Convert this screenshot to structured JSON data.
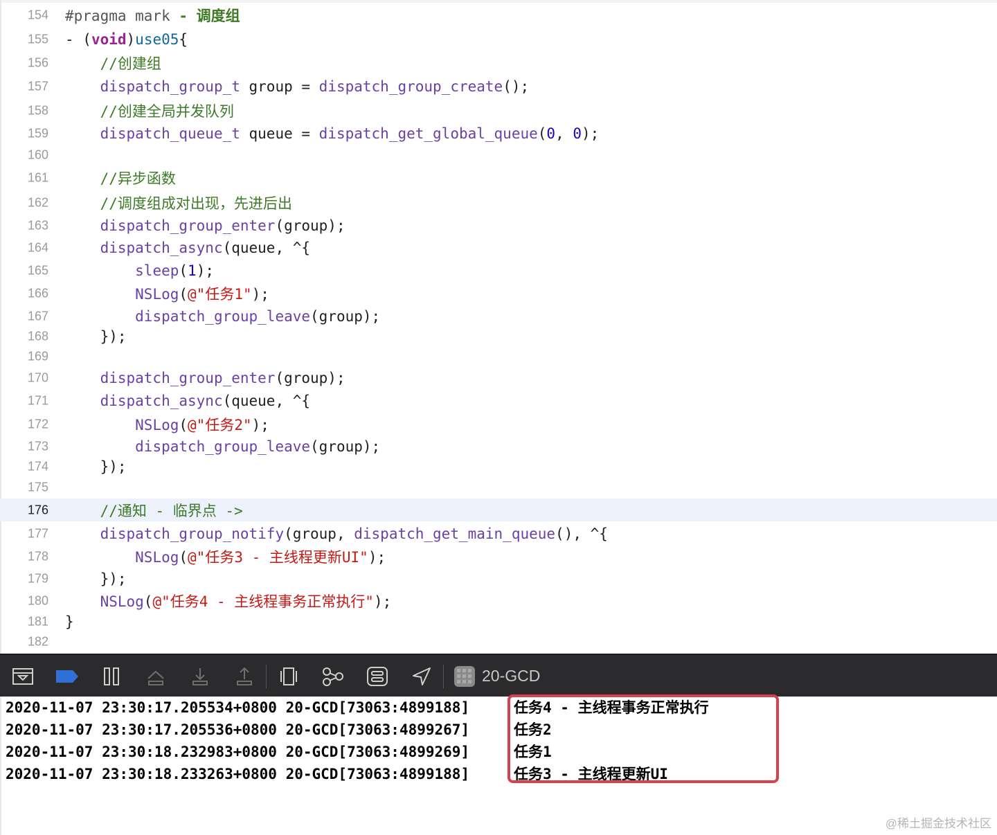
{
  "editor": {
    "current_line": "176",
    "lines": [
      {
        "num": "154",
        "tokens": [
          {
            "t": "#pragma mark ",
            "c": "hash"
          },
          {
            "t": "- 调度组",
            "c": "mark"
          }
        ]
      },
      {
        "num": "155",
        "tokens": [
          {
            "t": "- (",
            "c": "plain"
          },
          {
            "t": "void",
            "c": "kw"
          },
          {
            "t": ")",
            "c": "plain"
          },
          {
            "t": "use05",
            "c": "def"
          },
          {
            "t": "{",
            "c": "plain"
          }
        ]
      },
      {
        "num": "156",
        "tokens": [
          {
            "t": "    //创建组",
            "c": "com"
          }
        ]
      },
      {
        "num": "157",
        "tokens": [
          {
            "t": "    ",
            "c": "plain"
          },
          {
            "t": "dispatch_group_t",
            "c": "fn"
          },
          {
            "t": " group = ",
            "c": "plain"
          },
          {
            "t": "dispatch_group_create",
            "c": "fn"
          },
          {
            "t": "();",
            "c": "plain"
          }
        ]
      },
      {
        "num": "158",
        "tokens": [
          {
            "t": "    //创建全局并发队列",
            "c": "com"
          }
        ]
      },
      {
        "num": "159",
        "tokens": [
          {
            "t": "    ",
            "c": "plain"
          },
          {
            "t": "dispatch_queue_t",
            "c": "fn"
          },
          {
            "t": " queue = ",
            "c": "plain"
          },
          {
            "t": "dispatch_get_global_queue",
            "c": "fn"
          },
          {
            "t": "(",
            "c": "plain"
          },
          {
            "t": "0",
            "c": "num"
          },
          {
            "t": ", ",
            "c": "plain"
          },
          {
            "t": "0",
            "c": "num"
          },
          {
            "t": ");",
            "c": "plain"
          }
        ]
      },
      {
        "num": "160",
        "tokens": []
      },
      {
        "num": "161",
        "tokens": [
          {
            "t": "    //异步函数",
            "c": "com"
          }
        ]
      },
      {
        "num": "162",
        "tokens": [
          {
            "t": "    //调度组成对出现，先进后出",
            "c": "com"
          }
        ]
      },
      {
        "num": "163",
        "tokens": [
          {
            "t": "    ",
            "c": "plain"
          },
          {
            "t": "dispatch_group_enter",
            "c": "fn"
          },
          {
            "t": "(group);",
            "c": "plain"
          }
        ]
      },
      {
        "num": "164",
        "tokens": [
          {
            "t": "    ",
            "c": "plain"
          },
          {
            "t": "dispatch_async",
            "c": "fn"
          },
          {
            "t": "(queue, ^{",
            "c": "plain"
          }
        ]
      },
      {
        "num": "165",
        "tokens": [
          {
            "t": "        ",
            "c": "plain"
          },
          {
            "t": "sleep",
            "c": "fn"
          },
          {
            "t": "(",
            "c": "plain"
          },
          {
            "t": "1",
            "c": "num"
          },
          {
            "t": ");",
            "c": "plain"
          }
        ]
      },
      {
        "num": "166",
        "tokens": [
          {
            "t": "        ",
            "c": "plain"
          },
          {
            "t": "NSLog",
            "c": "fn"
          },
          {
            "t": "(",
            "c": "plain"
          },
          {
            "t": "@\"任务1\"",
            "c": "str"
          },
          {
            "t": ");",
            "c": "plain"
          }
        ]
      },
      {
        "num": "167",
        "tokens": [
          {
            "t": "        ",
            "c": "plain"
          },
          {
            "t": "dispatch_group_leave",
            "c": "fn"
          },
          {
            "t": "(group);",
            "c": "plain"
          }
        ]
      },
      {
        "num": "168",
        "tokens": [
          {
            "t": "    });",
            "c": "plain"
          }
        ]
      },
      {
        "num": "169",
        "tokens": []
      },
      {
        "num": "170",
        "tokens": [
          {
            "t": "    ",
            "c": "plain"
          },
          {
            "t": "dispatch_group_enter",
            "c": "fn"
          },
          {
            "t": "(group);",
            "c": "plain"
          }
        ]
      },
      {
        "num": "171",
        "tokens": [
          {
            "t": "    ",
            "c": "plain"
          },
          {
            "t": "dispatch_async",
            "c": "fn"
          },
          {
            "t": "(queue, ^{",
            "c": "plain"
          }
        ]
      },
      {
        "num": "172",
        "tokens": [
          {
            "t": "        ",
            "c": "plain"
          },
          {
            "t": "NSLog",
            "c": "fn"
          },
          {
            "t": "(",
            "c": "plain"
          },
          {
            "t": "@\"任务2\"",
            "c": "str"
          },
          {
            "t": ");",
            "c": "plain"
          }
        ]
      },
      {
        "num": "173",
        "tokens": [
          {
            "t": "        ",
            "c": "plain"
          },
          {
            "t": "dispatch_group_leave",
            "c": "fn"
          },
          {
            "t": "(group);",
            "c": "plain"
          }
        ]
      },
      {
        "num": "174",
        "tokens": [
          {
            "t": "    });",
            "c": "plain"
          }
        ]
      },
      {
        "num": "175",
        "tokens": []
      },
      {
        "num": "176",
        "tokens": [
          {
            "t": "    //通知 - 临界点 ->",
            "c": "com"
          }
        ]
      },
      {
        "num": "177",
        "tokens": [
          {
            "t": "    ",
            "c": "plain"
          },
          {
            "t": "dispatch_group_notify",
            "c": "fn"
          },
          {
            "t": "(group, ",
            "c": "plain"
          },
          {
            "t": "dispatch_get_main_queue",
            "c": "fn"
          },
          {
            "t": "(), ^{",
            "c": "plain"
          }
        ]
      },
      {
        "num": "178",
        "tokens": [
          {
            "t": "        ",
            "c": "plain"
          },
          {
            "t": "NSLog",
            "c": "fn"
          },
          {
            "t": "(",
            "c": "plain"
          },
          {
            "t": "@\"任务3 - 主线程更新UI\"",
            "c": "str"
          },
          {
            "t": ");",
            "c": "plain"
          }
        ]
      },
      {
        "num": "179",
        "tokens": [
          {
            "t": "    });",
            "c": "plain"
          }
        ]
      },
      {
        "num": "180",
        "tokens": [
          {
            "t": "    ",
            "c": "plain"
          },
          {
            "t": "NSLog",
            "c": "fn"
          },
          {
            "t": "(",
            "c": "plain"
          },
          {
            "t": "@\"任务4 - 主线程事务正常执行\"",
            "c": "str"
          },
          {
            "t": ");",
            "c": "plain"
          }
        ]
      },
      {
        "num": "181",
        "tokens": [
          {
            "t": "}",
            "c": "plain"
          }
        ]
      },
      {
        "num": "182",
        "tokens": []
      }
    ]
  },
  "debug_bar": {
    "icons": [
      "hide-console-icon",
      "breakpoints-toggle-icon",
      "pause-icon",
      "step-over-icon",
      "step-into-icon",
      "step-out-icon",
      "view-debugger-icon",
      "memory-graph-icon",
      "environment-overrides-icon",
      "simulate-location-icon",
      "target-app-icon"
    ],
    "target": "20-GCD"
  },
  "console": {
    "logs": [
      {
        "prefix": "2020-11-07 23:30:17.205534+0800 20-GCD[73063:4899188]",
        "message": "任务4 - 主线程事务正常执行"
      },
      {
        "prefix": "2020-11-07 23:30:17.205536+0800 20-GCD[73063:4899267]",
        "message": "任务2"
      },
      {
        "prefix": "2020-11-07 23:30:18.232983+0800 20-GCD[73063:4899269]",
        "message": "任务1"
      },
      {
        "prefix": "2020-11-07 23:30:18.233263+0800 20-GCD[73063:4899188]",
        "message": "任务3 - 主线程更新UI"
      }
    ]
  },
  "colors": {
    "highlight_box": "#d6404f",
    "current_line_bg": "#ecf1fc",
    "toolbar_bg": "#2b2b2d",
    "function": "#6a3fa6",
    "comment": "#3e7a27",
    "string": "#c41a16",
    "number": "#1c00cf",
    "keyword": "#9b2393"
  },
  "watermark": "@稀土掘金技术社区"
}
